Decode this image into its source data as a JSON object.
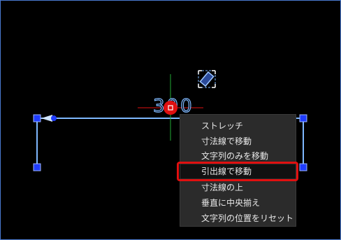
{
  "dimension": {
    "value_text": "300"
  },
  "context_menu": {
    "items": [
      {
        "label": "ストレッチ"
      },
      {
        "label": "寸法線で移動"
      },
      {
        "label": "文字列のみを移動"
      },
      {
        "label": "引出線で移動",
        "highlighted": true
      },
      {
        "label": "寸法線の上"
      },
      {
        "label": "垂直に中央揃え"
      },
      {
        "label": "文字列の位置をリセット"
      }
    ]
  },
  "colors": {
    "background": "#000000",
    "dimension": "#7fb8ff",
    "grip": "#1f3cff",
    "grip_hot": "#e01010",
    "crosshair_x": "#e01010",
    "crosshair_y": "#22aa33",
    "menu_bg": "#2b2b2b",
    "callout": "#e01010"
  },
  "icons": [
    "move-text-icon",
    "text-grip-icon"
  ]
}
